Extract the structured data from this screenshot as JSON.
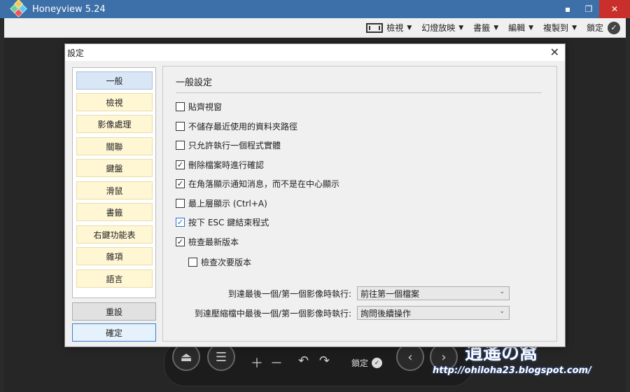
{
  "window": {
    "title": "Honeyview 5.24",
    "minimize_glyph": "▪",
    "restore_glyph": "❐",
    "close_glyph": "✕"
  },
  "toolbar": {
    "items": [
      {
        "label": "檢視",
        "icon": "frame-icon"
      },
      {
        "label": "幻燈放映"
      },
      {
        "label": "書籤"
      },
      {
        "label": "編輯"
      },
      {
        "label": "複製到"
      }
    ],
    "lock_label": "鎖定"
  },
  "dialog": {
    "title": "設定",
    "nav": [
      "一般",
      "檢視",
      "影像處理",
      "關聯",
      "鍵盤",
      "滑鼠",
      "書籤",
      "右鍵功能表",
      "雜項",
      "語言"
    ],
    "active_nav": "一般",
    "reset_label": "重設",
    "ok_label": "確定",
    "section_title": "一般設定",
    "options": [
      {
        "label": "貼齊視窗",
        "checked": false
      },
      {
        "label": "不儲存最近使用的資料夾路徑",
        "checked": false
      },
      {
        "label": "只允許執行一個程式實體",
        "checked": false
      },
      {
        "label": "刪除檔案時進行確認",
        "checked": true
      },
      {
        "label": "在角落顯示通知消息，而不是在中心顯示",
        "checked": true
      },
      {
        "label": "最上層顯示 (Ctrl+A)",
        "checked": false
      },
      {
        "label": "按下 ESC 鍵結束程式",
        "checked": true
      },
      {
        "label": "檢查最新版本",
        "checked": true
      },
      {
        "label": "檢查次要版本",
        "checked": false
      }
    ],
    "dropdown1_label": "到達最後一個/第一個影像時執行:",
    "dropdown1_value": "前往第一個檔案",
    "dropdown2_label": "到達壓縮檔中最後一個/第一個影像時執行:",
    "dropdown2_value": "詢問後續操作"
  },
  "viewer_bar": {
    "lock_label": "鎖定"
  },
  "watermark": {
    "logo_text": "逍遙の窩",
    "url": "http://ohiloha23.blogspot.com/"
  }
}
